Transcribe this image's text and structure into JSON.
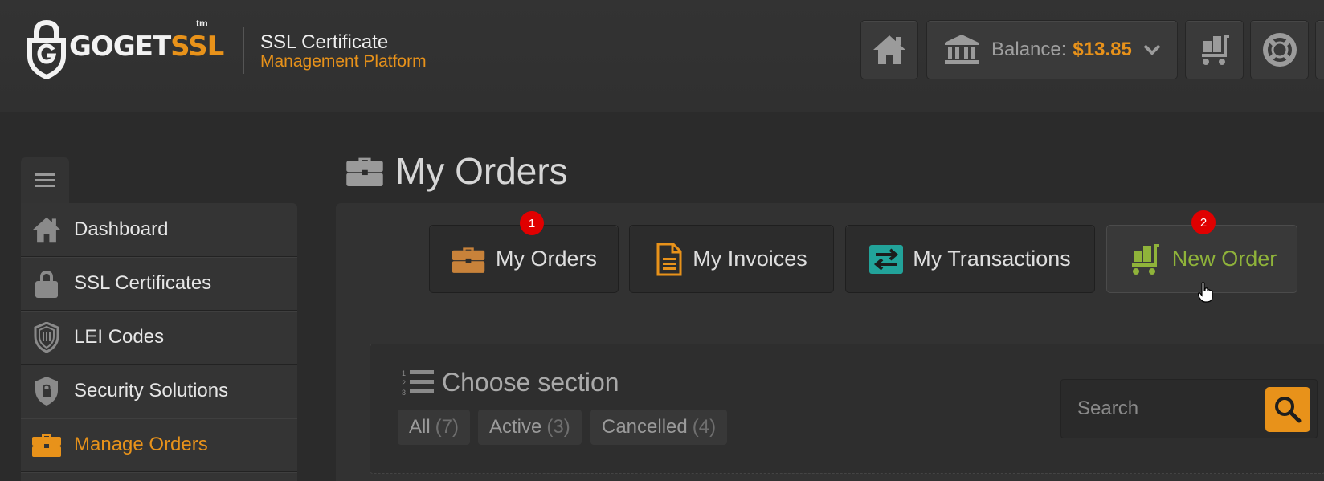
{
  "header": {
    "logo": {
      "text_main": "GOGET",
      "text_accent": "SSL",
      "trademark": "tm"
    },
    "platform_line1": "SSL Certificate",
    "platform_line2": "Management Platform",
    "balance_label": "Balance:",
    "balance_value": "$13.85",
    "icons": [
      "home-icon",
      "bank-icon",
      "chevron-down-icon",
      "cart-icon",
      "lifebuoy-icon"
    ]
  },
  "sidebar": {
    "toggle_icon": "hamburger-icon",
    "items": [
      {
        "label": "Dashboard",
        "icon": "home-icon",
        "active": false
      },
      {
        "label": "SSL Certificates",
        "icon": "lock-icon",
        "active": false
      },
      {
        "label": "LEI Codes",
        "icon": "lei-shield-icon",
        "active": false
      },
      {
        "label": "Security Solutions",
        "icon": "shield-lock-icon",
        "active": false
      },
      {
        "label": "Manage Orders",
        "icon": "briefcase-icon",
        "active": true
      }
    ]
  },
  "main": {
    "title": "My Orders",
    "tabs": [
      {
        "label": "My Orders",
        "icon": "briefcase-icon",
        "badge": "1"
      },
      {
        "label": "My Invoices",
        "icon": "document-icon"
      },
      {
        "label": "My Transactions",
        "icon": "transfer-icon"
      },
      {
        "label": "New Order",
        "icon": "cart-icon",
        "badge": "2"
      }
    ],
    "section_title": "Choose section",
    "filters": [
      {
        "label": "All",
        "count": "(7)"
      },
      {
        "label": "Active",
        "count": "(3)"
      },
      {
        "label": "Cancelled",
        "count": "(4)"
      }
    ],
    "search": {
      "placeholder": "Search"
    }
  },
  "colors": {
    "accent": "#e8921a",
    "green": "#8fb33a",
    "teal": "#22a39a",
    "badge": "#e00000"
  }
}
